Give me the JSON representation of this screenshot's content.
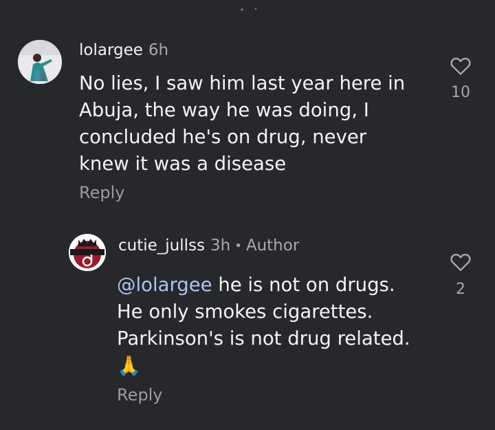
{
  "top_comment": {
    "username": "lolargee",
    "time": "6h",
    "lines": [
      "No lies, I saw him last year here in",
      "Abuja, the way he was doing, I",
      "concluded he's on drug, never",
      "knew it was a disease"
    ],
    "reply_label": "Reply",
    "like_count": "10",
    "like_icon": "heart-outline-icon"
  },
  "reply_comment": {
    "username": "cutie_jullss",
    "time": "3h",
    "separator": "•",
    "author_label": "Author",
    "avatar_text": "CUTIE_JULS",
    "mention": "@lolargee",
    "line1_rest": " he is not on drugs.",
    "lines": [
      "He only smokes cigarettes.",
      "Parkinson's is not drug related."
    ],
    "emoji": "🙏",
    "reply_label": "Reply",
    "like_count": "2",
    "like_icon": "heart-outline-icon"
  },
  "colors": {
    "background": "#27282c",
    "text": "#f2f2f2",
    "muted": "#a9a9ad",
    "mention": "#a9c6ef"
  }
}
